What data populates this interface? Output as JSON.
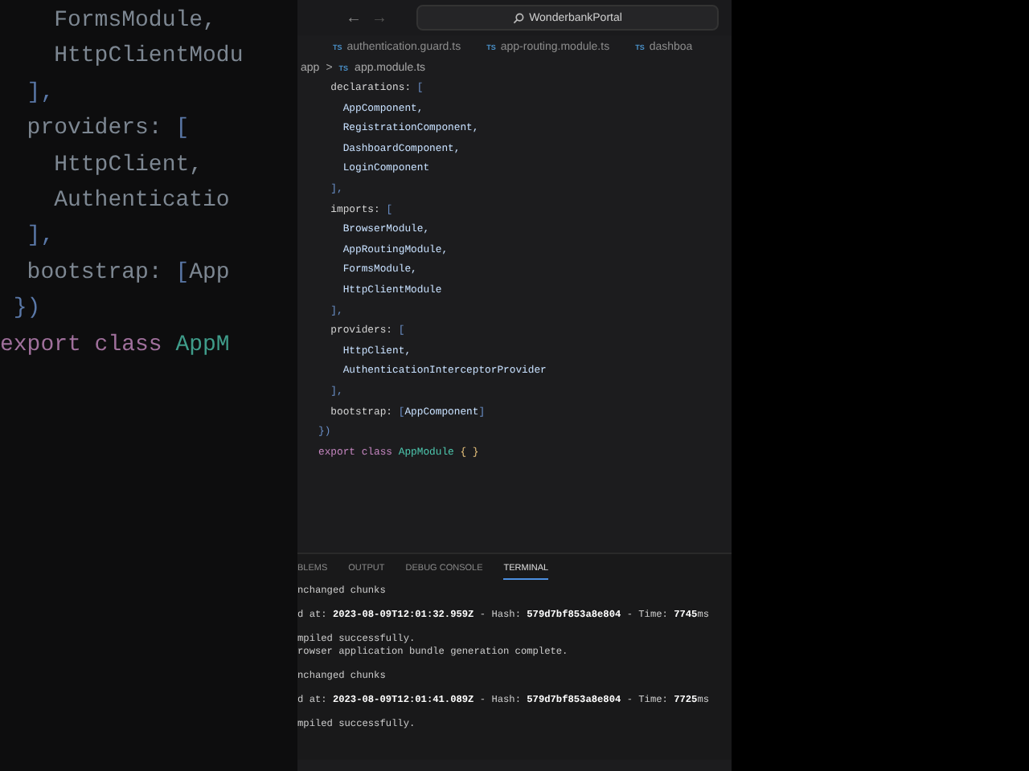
{
  "backdrop": {
    "lines": [
      [
        {
          "t": "    FormsModule,",
          "kind": "ident"
        }
      ],
      [
        {
          "t": "    HttpClientModu",
          "kind": "ident"
        }
      ],
      [
        {
          "t": "  ],",
          "kind": "bracket"
        }
      ],
      [
        {
          "t": "  providers: ",
          "kind": "plain"
        },
        {
          "t": "[",
          "kind": "bracket"
        }
      ],
      [
        {
          "t": "    HttpClient,",
          "kind": "ident"
        }
      ],
      [
        {
          "t": "    Authenticatio",
          "kind": "ident"
        }
      ],
      [
        {
          "t": "  ],",
          "kind": "bracket"
        }
      ],
      [
        {
          "t": "  bootstrap: ",
          "kind": "plain"
        },
        {
          "t": "[",
          "kind": "bracket"
        },
        {
          "t": "App",
          "kind": "ident"
        }
      ],
      [
        {
          "t": " })",
          "kind": "bracket"
        }
      ],
      [
        {
          "t": "export class ",
          "kind": "keyword"
        },
        {
          "t": "AppM",
          "kind": "type"
        }
      ]
    ]
  },
  "titlebar": {
    "back": "←",
    "forward": "→",
    "search": "WonderbankPortal"
  },
  "tabs": [
    {
      "icon": "TS",
      "label": "authentication.guard.ts",
      "selected": false
    },
    {
      "icon": "TS",
      "label": "app-routing.module.ts",
      "selected": false
    },
    {
      "icon": "TS",
      "label": "dashboa",
      "selected": false
    }
  ],
  "breadcrumb": {
    "folder": "app",
    "separator": ">",
    "icon": "TS",
    "file": "app.module.ts"
  },
  "code": [
    [
      {
        "t": "  declarations: ",
        "kind": "plain"
      },
      {
        "t": "[",
        "kind": "bracket"
      }
    ],
    [
      {
        "t": "    AppComponent,",
        "kind": "ident"
      }
    ],
    [
      {
        "t": "    RegistrationComponent,",
        "kind": "ident"
      }
    ],
    [
      {
        "t": "    DashboardComponent,",
        "kind": "ident"
      }
    ],
    [
      {
        "t": "    LoginComponent",
        "kind": "ident"
      }
    ],
    [
      {
        "t": "  ],",
        "kind": "bracket"
      }
    ],
    [
      {
        "t": "  imports: ",
        "kind": "plain"
      },
      {
        "t": "[",
        "kind": "bracket"
      }
    ],
    [
      {
        "t": "    BrowserModule,",
        "kind": "ident"
      }
    ],
    [
      {
        "t": "    AppRoutingModule,",
        "kind": "ident"
      }
    ],
    [
      {
        "t": "    FormsModule,",
        "kind": "ident"
      }
    ],
    [
      {
        "t": "    HttpClientModule",
        "kind": "ident"
      }
    ],
    [
      {
        "t": "  ],",
        "kind": "bracket"
      }
    ],
    [
      {
        "t": "  providers: ",
        "kind": "plain"
      },
      {
        "t": "[",
        "kind": "bracket"
      }
    ],
    [
      {
        "t": "    HttpClient,",
        "kind": "ident"
      }
    ],
    [
      {
        "t": "    AuthenticationInterceptorProvider",
        "kind": "ident"
      }
    ],
    [
      {
        "t": "  ],",
        "kind": "bracket"
      }
    ],
    [
      {
        "t": "  bootstrap: ",
        "kind": "plain"
      },
      {
        "t": "[",
        "kind": "bracket"
      },
      {
        "t": "AppComponent",
        "kind": "ident"
      },
      {
        "t": "]",
        "kind": "bracket"
      }
    ],
    [
      {
        "t": "})",
        "kind": "bracket"
      }
    ],
    [
      {
        "t": "export class ",
        "kind": "keyword"
      },
      {
        "t": "AppModule ",
        "kind": "type"
      },
      {
        "t": "{ }",
        "kind": "brace"
      }
    ]
  ],
  "panel_tabs": [
    {
      "label": "BLEMS",
      "selected": false
    },
    {
      "label": "OUTPUT",
      "selected": false
    },
    {
      "label": "DEBUG CONSOLE",
      "selected": false
    },
    {
      "label": "TERMINAL",
      "selected": true
    }
  ],
  "terminal": {
    "blocks": [
      [
        "nchanged chunks"
      ],
      [
        "d at: **2023-08-09T12:01:32.959Z** - Hash: **579d7bf853a8e804** - Time: **7745**ms"
      ],
      [
        "mpiled successfully.",
        "rowser application bundle generation complete."
      ],
      [
        "nchanged chunks"
      ],
      [
        "d at: **2023-08-09T12:01:41.089Z** - Hash: **579d7bf853a8e804** - Time: **7725**ms"
      ],
      [
        "mpiled successfully."
      ]
    ]
  }
}
